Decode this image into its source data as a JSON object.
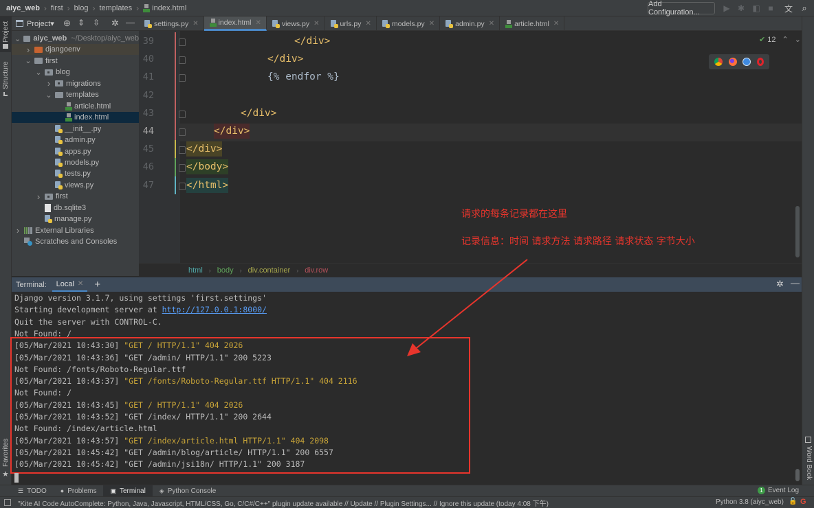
{
  "navbar": {
    "breadcrumb": [
      "aiyc_web",
      "first",
      "blog",
      "templates",
      "index.html"
    ],
    "add_configuration": "Add Configuration..."
  },
  "left_strip": {
    "project": "Project",
    "structure": "Structure",
    "favorites": "Favorites"
  },
  "right_strip": {
    "word_book": "Word Book"
  },
  "project_panel": {
    "title": "Project",
    "tree": [
      {
        "label": "aiyc_web",
        "hint": "~/Desktop/aiyc_web",
        "type": "folder",
        "depth": 0,
        "expanded": true
      },
      {
        "label": "djangoenv",
        "type": "folder-excluded",
        "depth": 1,
        "expanded": false
      },
      {
        "label": "first",
        "type": "folder",
        "depth": 1,
        "expanded": true
      },
      {
        "label": "blog",
        "type": "package",
        "depth": 2,
        "expanded": true
      },
      {
        "label": "migrations",
        "type": "package",
        "depth": 3,
        "expanded": false
      },
      {
        "label": "templates",
        "type": "folder",
        "depth": 3,
        "expanded": true
      },
      {
        "label": "article.html",
        "type": "html",
        "depth": 4
      },
      {
        "label": "index.html",
        "type": "html",
        "depth": 4,
        "selected": true
      },
      {
        "label": "__init__.py",
        "type": "py",
        "depth": 3
      },
      {
        "label": "admin.py",
        "type": "py",
        "depth": 3
      },
      {
        "label": "apps.py",
        "type": "py",
        "depth": 3
      },
      {
        "label": "models.py",
        "type": "py",
        "depth": 3
      },
      {
        "label": "tests.py",
        "type": "py",
        "depth": 3
      },
      {
        "label": "views.py",
        "type": "py",
        "depth": 3
      },
      {
        "label": "first",
        "type": "package",
        "depth": 2,
        "expanded": false
      },
      {
        "label": "db.sqlite3",
        "type": "file",
        "depth": 2
      },
      {
        "label": "manage.py",
        "type": "py",
        "depth": 2
      },
      {
        "label": "External Libraries",
        "type": "libs",
        "depth": 0,
        "expanded": false
      },
      {
        "label": "Scratches and Consoles",
        "type": "scratch",
        "depth": 0
      }
    ]
  },
  "editor": {
    "tabs": [
      {
        "label": "settings.py",
        "type": "py"
      },
      {
        "label": "index.html",
        "type": "html",
        "active": true
      },
      {
        "label": "views.py",
        "type": "py"
      },
      {
        "label": "urls.py",
        "type": "py"
      },
      {
        "label": "models.py",
        "type": "py"
      },
      {
        "label": "admin.py",
        "type": "py"
      },
      {
        "label": "article.html",
        "type": "html"
      }
    ],
    "inspection_count": "12",
    "lines": [
      {
        "num": "39",
        "text": "</div>"
      },
      {
        "num": "40",
        "text": "</div>"
      },
      {
        "num": "41",
        "text": "{% endfor %}"
      },
      {
        "num": "42",
        "text": ""
      },
      {
        "num": "43",
        "text": "</div>"
      },
      {
        "num": "44",
        "text": "</div>"
      },
      {
        "num": "45",
        "text": "</div>"
      },
      {
        "num": "46",
        "text": "</body>"
      },
      {
        "num": "47",
        "text": "</html>"
      }
    ],
    "current_line": "44",
    "breadcrumb": [
      "html",
      "body",
      "div.container",
      "div.row"
    ]
  },
  "annotations": {
    "line1": "请求的每条记录都在这里",
    "line2": "记录信息：时间 请求方法 请求路径 请求状态 字节大小",
    "color": "#e8352c"
  },
  "terminal": {
    "label": "Terminal:",
    "tab": "Local",
    "lines": [
      {
        "text": "Django version 3.1.7, using settings 'first.settings'"
      },
      {
        "prefix": "Starting development server at ",
        "link": "http://127.0.0.1:8000/"
      },
      {
        "text": "Quit the server with CONTROL-C."
      },
      {
        "text": "Not Found: /"
      },
      {
        "ts": "[05/Mar/2021 10:43:30] ",
        "req": "\"GET / HTTP/1.1\" 404 2026",
        "warn": true
      },
      {
        "ts": "[05/Mar/2021 10:43:36] ",
        "req": "\"GET /admin/ HTTP/1.1\" 200 5223",
        "warn": false
      },
      {
        "text": "Not Found: /fonts/Roboto-Regular.ttf"
      },
      {
        "ts": "[05/Mar/2021 10:43:37] ",
        "req": "\"GET /fonts/Roboto-Regular.ttf HTTP/1.1\" 404 2116",
        "warn": true
      },
      {
        "text": "Not Found: /"
      },
      {
        "ts": "[05/Mar/2021 10:43:45] ",
        "req": "\"GET / HTTP/1.1\" 404 2026",
        "warn": true
      },
      {
        "ts": "[05/Mar/2021 10:43:52] ",
        "req": "\"GET /index/ HTTP/1.1\" 200 2644",
        "warn": false
      },
      {
        "text": "Not Found: /index/article.html"
      },
      {
        "ts": "[05/Mar/2021 10:43:57] ",
        "req": "\"GET /index/article.html HTTP/1.1\" 404 2098",
        "warn": true
      },
      {
        "ts": "[05/Mar/2021 10:45:42] ",
        "req": "\"GET /admin/blog/article/ HTTP/1.1\" 200 6557",
        "warn": false
      },
      {
        "ts": "[05/Mar/2021 10:45:42] ",
        "req": "\"GET /admin/jsi18n/ HTTP/1.1\" 200 3187",
        "warn": false
      }
    ]
  },
  "bottom_tabs": [
    {
      "label": "TODO",
      "icon": "list-icon"
    },
    {
      "label": "Problems",
      "icon": "info-icon"
    },
    {
      "label": "Terminal",
      "icon": "terminal-icon",
      "active": true
    },
    {
      "label": "Python Console",
      "icon": "python-icon"
    }
  ],
  "event_log": {
    "count": "1",
    "label": "Event Log"
  },
  "status_bar": {
    "message": "\"Kite AI Code AutoComplete: Python, Java, Javascript, HTML/CSS, Go, C/C#/C++\" plugin update available // Update // Plugin Settings... // Ignore this update (today 4:08 下午)",
    "interpreter": "Python 3.8 (aiyc_web)"
  }
}
